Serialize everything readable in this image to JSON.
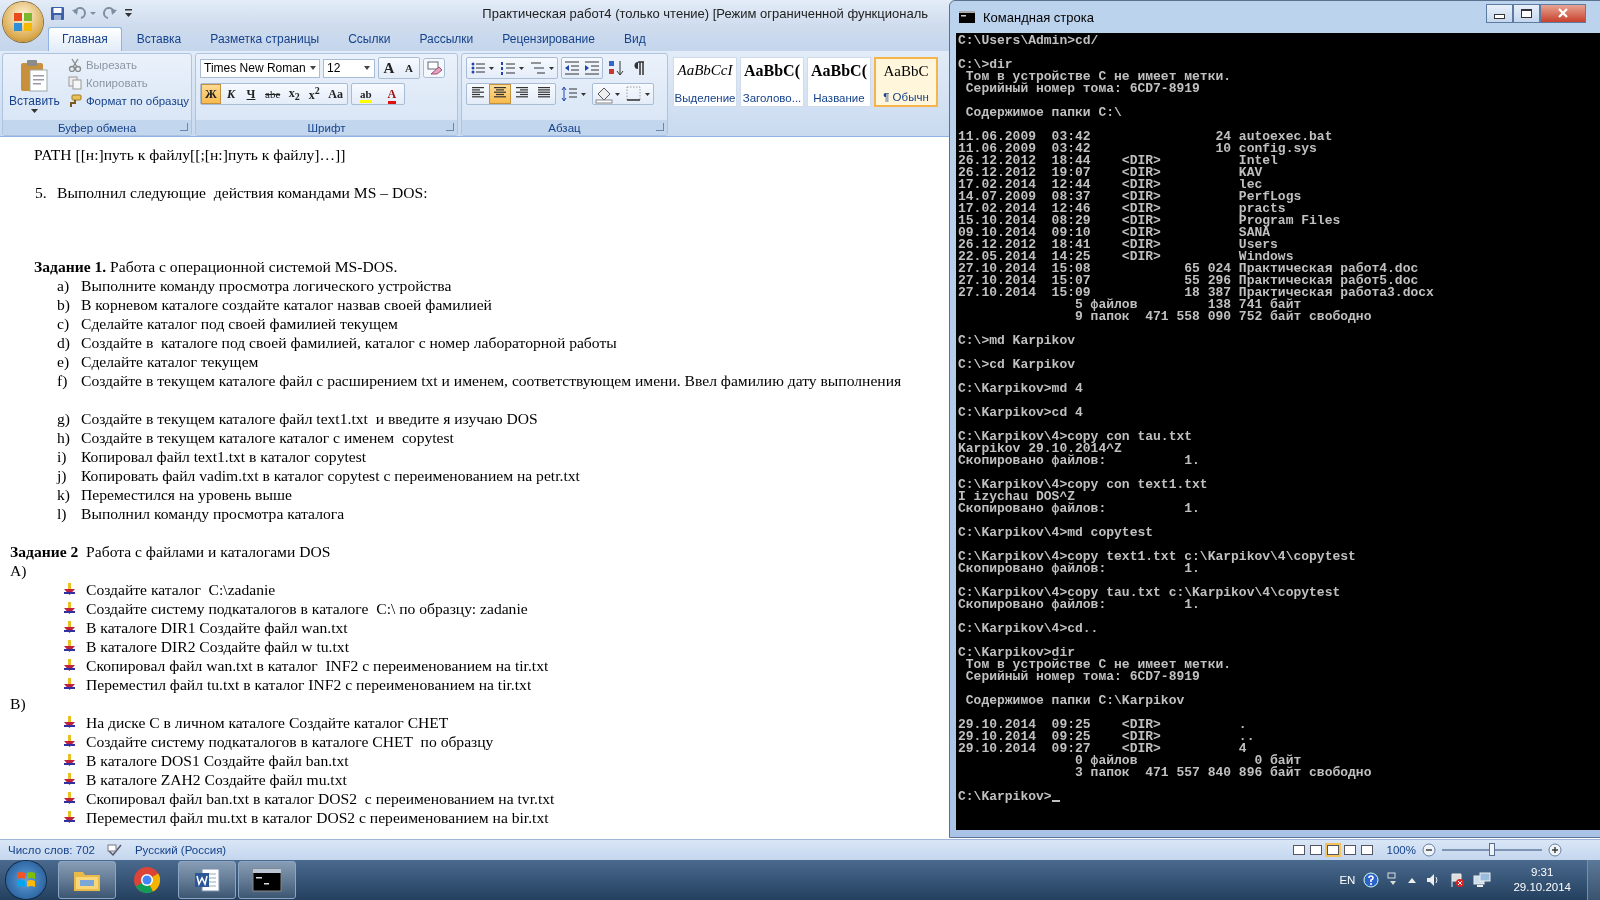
{
  "word": {
    "title": "Практическая работ4 (только чтение) [Режим ограниченной функциональ",
    "tabs": [
      {
        "label": "Главная",
        "selected": true
      },
      {
        "label": "Вставка",
        "selected": false
      },
      {
        "label": "Разметка страницы",
        "selected": false
      },
      {
        "label": "Ссылки",
        "selected": false
      },
      {
        "label": "Рассылки",
        "selected": false
      },
      {
        "label": "Рецензирование",
        "selected": false
      },
      {
        "label": "Вид",
        "selected": false
      }
    ],
    "clipboard": {
      "group": "Буфер обмена",
      "paste": "Вставить",
      "actions": [
        {
          "label": "Вырезать",
          "kind": "cut",
          "disabled": true
        },
        {
          "label": "Копировать",
          "kind": "copy",
          "disabled": true
        },
        {
          "label": "Формат по образцу",
          "kind": "format",
          "disabled": false
        }
      ]
    },
    "font": {
      "group": "Шрифт",
      "family": "Times New Roman",
      "size": "12",
      "grow": "A",
      "shrink": "A",
      "buttons": [
        {
          "label": "Ж",
          "kind": "bold",
          "selected": true
        },
        {
          "label": "К",
          "kind": "italic",
          "selected": false
        },
        {
          "label": "Ч",
          "kind": "underline",
          "selected": false
        },
        {
          "label": "abe",
          "kind": "strike",
          "selected": false
        },
        {
          "label": "x$_{2}$",
          "kind": "sub",
          "selected": false
        },
        {
          "label": "x$^{2}$",
          "kind": "sup",
          "selected": false
        },
        {
          "label": "Aa",
          "kind": "case",
          "selected": false
        }
      ],
      "highlight": "ab",
      "color_label": "A"
    },
    "paragraph": {
      "group": "Абзац",
      "align": [
        {
          "kind": "left",
          "selected": false
        },
        {
          "kind": "center",
          "selected": true
        },
        {
          "kind": "right",
          "selected": false
        },
        {
          "kind": "justify",
          "selected": false
        }
      ]
    },
    "styles": [
      {
        "preview": "AaBbCcI",
        "name": "Выделение",
        "kind": "emphasis",
        "selected": false
      },
      {
        "preview": "AaBbC(",
        "name": "Заголово...",
        "kind": "heading",
        "selected": false
      },
      {
        "preview": "AaBbC(",
        "name": "Название",
        "kind": "title",
        "selected": false
      },
      {
        "preview": "AaBbC",
        "name": "¶ Обычн",
        "kind": "normal",
        "selected": true
      }
    ]
  },
  "document": {
    "blocks": [
      {
        "kind": "para",
        "text": "PATH [[н:]путь к файлу[[;[н:]путь к файлу]…]]"
      },
      {
        "kind": "numbered",
        "marker": "5.",
        "text": "Выполнил следующие  действия командами MS – DOS:"
      },
      {
        "kind": "heading",
        "text": "**Задание 1.** Работа с операционной системой MS-DOS."
      },
      {
        "kind": "lettered",
        "items": [
          {
            "marker": "a)",
            "text": "Выполните команду просмотра логического устройства"
          },
          {
            "marker": "b)",
            "text": "В корневом каталоге создайте каталог назвав своей фамилией"
          },
          {
            "marker": "c)",
            "text": "Сделайте каталог под своей фамилией текущем"
          },
          {
            "marker": "d)",
            "text": "Создайте в  каталоге под своей фамилией, каталог с номер лабораторной работы"
          },
          {
            "marker": "e)",
            "text": "Сделайте каталог текущем"
          },
          {
            "marker": "f)",
            "text": "Создайте в текущем каталоге файл с расширением txt и именем, соответствующем имени. Ввел фамилию дату выполнения"
          }
        ]
      },
      {
        "kind": "lettered",
        "items": [
          {
            "marker": "g)",
            "text": "Создайте в текущем каталоге файл text1.txt  и введите я изучаю DOS"
          },
          {
            "marker": "h)",
            "text": "Создайте в текущем каталоге каталог с именем  copytest"
          },
          {
            "marker": "i)",
            "text": "Копировал файл text1.txt в каталог copytest"
          },
          {
            "marker": "j)",
            "text": "Копировать файл vadim.txt в каталог copytest с переименованием на petr.txt"
          },
          {
            "marker": "k)",
            "text": "Переместился на уровень выше"
          },
          {
            "marker": "l)",
            "text": "Выполнил команду просмотра каталога"
          }
        ]
      },
      {
        "kind": "section",
        "text": "**Задание 2**  Работа с файлами и каталогами DOS"
      },
      {
        "kind": "section",
        "text": "А)"
      },
      {
        "kind": "bullets",
        "items": [
          "Создайте каталог  C:\\zadanie",
          "Создайте систему подкаталогов в каталоге  C:\\ по образцу: zadanie",
          "В каталоге DIR1 Создайте файл wan.txt",
          "В каталоге DIR2 Создайте файл w tu.txt",
          "Скопировал файл wan.txt в каталог  INF2 с переименованием на tir.txt",
          "Переместил файл tu.txt в каталог INF2 с переименованием на tir.txt"
        ]
      },
      {
        "kind": "section",
        "text": "В)"
      },
      {
        "kind": "bullets",
        "items": [
          "На диске С в личном каталоге Создайте каталог CHET",
          "Создайте систему подкаталогов в каталоге CHET  по образцу",
          "В каталоге DOS1 Создайте файл ban.txt",
          "В каталоге ZAH2 Создайте файл mu.txt",
          "Скопировал файл ban.txt в каталог DOS2  с переименованием на tvr.txt",
          "Переместил файл mu.txt в каталог DOS2 с переименованием на bir.txt"
        ]
      }
    ]
  },
  "status_bar": {
    "words": "Число слов: 702",
    "language": "Русский (Россия)",
    "views": [
      {
        "selected": false
      },
      {
        "selected": false
      },
      {
        "selected": true
      },
      {
        "selected": false
      },
      {
        "selected": false
      }
    ],
    "zoom": "100%",
    "level": 0.5
  },
  "console": {
    "title": "Командная строка",
    "blocks": [
      [
        "C:\\Users\\Admin>cd/"
      ],
      [
        "C:\\>dir",
        " Том в устройстве C не имеет метки.",
        " Серийный номер тома: 6CD7-8919"
      ],
      [
        " Содержимое папки C:\\"
      ],
      [
        "11.06.2009  03:42                24 autoexec.bat",
        "11.06.2009  03:42                10 config.sys",
        "26.12.2012  18:44    <DIR>          Intel",
        "26.12.2012  19:07    <DIR>          KAV",
        "17.02.2014  12:44    <DIR>          lec",
        "14.07.2009  08:37    <DIR>          PerfLogs",
        "17.02.2014  12:46    <DIR>          practs",
        "15.10.2014  08:29    <DIR>          Program Files",
        "09.10.2014  09:10    <DIR>          SANA",
        "26.12.2012  18:41    <DIR>          Users",
        "22.05.2014  14:25    <DIR>          Windows",
        "27.10.2014  15:08            65 024 Практическая работ4.doc",
        "27.10.2014  15:07            55 296 Практическая работ5.doc",
        "27.10.2014  15:09            18 387 Практическая работа3.docx",
        "               5 файлов         138 741 байт",
        "               9 папок  471 558 090 752 байт свободно"
      ],
      [
        "C:\\>md Karpikov"
      ],
      [
        "C:\\>cd Karpikov"
      ],
      [
        "C:\\Karpikov>md 4"
      ],
      [
        "C:\\Karpikov>cd 4"
      ],
      [
        "C:\\Karpikov\\4>copy con tau.txt",
        "Karpikov 29.10.2014^Z",
        "Скопировано файлов:          1."
      ],
      [
        "C:\\Karpikov\\4>copy con text1.txt",
        "I izychau DOS^Z",
        "Скопировано файлов:          1."
      ],
      [
        "C:\\Karpikov\\4>md copytest"
      ],
      [
        "C:\\Karpikov\\4>copy text1.txt c:\\Karpikov\\4\\copytest",
        "Скопировано файлов:          1."
      ],
      [
        "C:\\Karpikov\\4>copy tau.txt c:\\Karpikov\\4\\copytest",
        "Скопировано файлов:          1."
      ],
      [
        "C:\\Karpikov\\4>cd.."
      ],
      [
        "C:\\Karpikov>dir",
        " Том в устройстве C не имеет метки.",
        " Серийный номер тома: 6CD7-8919"
      ],
      [
        " Содержимое папки C:\\Karpikov"
      ],
      [
        "29.10.2014  09:25    <DIR>          .",
        "29.10.2014  09:25    <DIR>          ..",
        "29.10.2014  09:27    <DIR>          4",
        "               0 файлов               0 байт",
        "               3 папок  471 557 840 896 байт свободно"
      ]
    ],
    "prompt": "C:\\Karpikov>"
  },
  "taskbar": {
    "apps": [
      {
        "kind": "explorer",
        "running": true
      },
      {
        "kind": "browser",
        "running": false
      },
      {
        "kind": "word",
        "running": true
      },
      {
        "kind": "console",
        "running": true
      }
    ],
    "language": "EN",
    "time": "9:31",
    "date": "29.10.2014"
  }
}
